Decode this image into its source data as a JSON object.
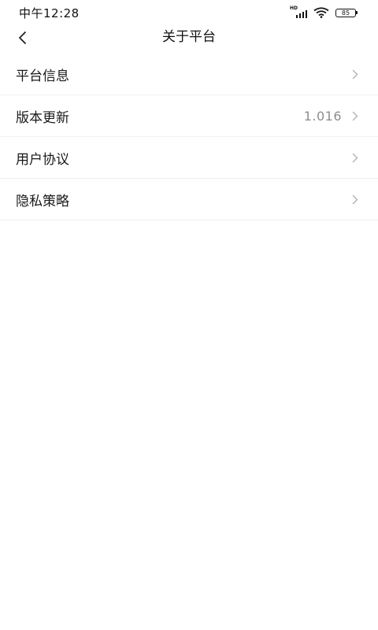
{
  "status_bar": {
    "time": "中午12:28",
    "network": "HD",
    "battery": "85"
  },
  "nav": {
    "title": "关于平台",
    "back_icon": "chevron-left-icon"
  },
  "menu": {
    "items": [
      {
        "label": "平台信息",
        "value": ""
      },
      {
        "label": "版本更新",
        "value": "1.016"
      },
      {
        "label": "用户协议",
        "value": ""
      },
      {
        "label": "隐私策略",
        "value": ""
      }
    ]
  },
  "colors": {
    "background": "#ffffff",
    "text": "#1a1a1a",
    "secondary_text": "#8d8d8d",
    "divider": "#f1f1f1",
    "chevron": "#b5b5b5"
  }
}
